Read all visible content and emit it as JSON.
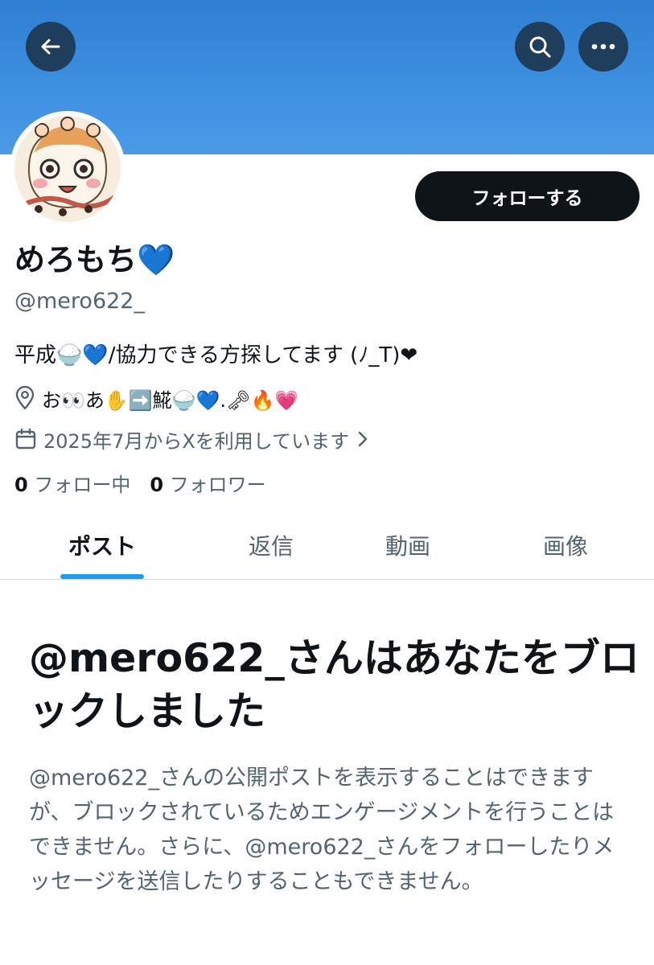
{
  "profile": {
    "display_name": "めろもち💙",
    "handle": "@mero622_",
    "bio": "平成🍚💙/協力できる方探してます (ﾉ_T)❤",
    "location": "お👀あ✋➡️𩸽🍚💙.🗝🔥💗",
    "joined": "2025年7月からXを利用しています"
  },
  "header": {
    "back_icon": "back-arrow-icon",
    "search_icon": "search-icon",
    "more_icon": "more-icon",
    "banner_color": "#3d8fe0"
  },
  "actions": {
    "follow_label": "フォローする"
  },
  "stats": {
    "following_count": "0",
    "following_label": "フォロー中",
    "followers_count": "0",
    "followers_label": "フォロワー"
  },
  "tabs": [
    {
      "label": "ポスト"
    },
    {
      "label": "返信"
    },
    {
      "label": "動画"
    },
    {
      "label": "画像"
    }
  ],
  "blocked": {
    "title": "@mero622_さんはあなたをブロックしました",
    "description": "@mero622_さんの公開ポストを表示することはできますが、ブロックされているためエンゲージメントを行うことはできません。さらに、@mero622_さんをフォローしたりメッセージを送信したりすることもできません。"
  },
  "colors": {
    "accent": "#1d9bf0",
    "text": "#0f1419",
    "secondary": "#536471"
  }
}
